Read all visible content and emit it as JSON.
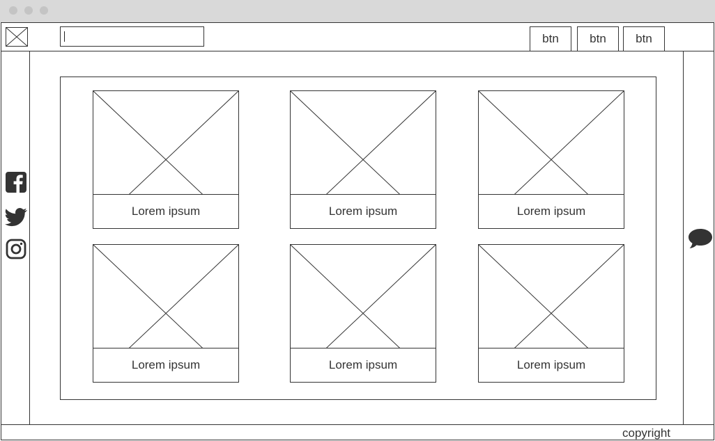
{
  "window": {
    "controls": [
      "close",
      "minimize",
      "maximize"
    ]
  },
  "header": {
    "logo_icon": "image-placeholder-icon",
    "search": {
      "value": "",
      "placeholder": ""
    },
    "buttons": [
      "btn",
      "btn",
      "btn"
    ]
  },
  "sidebar_left": {
    "icons": [
      "facebook-icon",
      "twitter-icon",
      "instagram-icon"
    ]
  },
  "sidebar_right": {
    "icons": [
      "chat-bubble-icon"
    ]
  },
  "cards": [
    {
      "label": "Lorem ipsum"
    },
    {
      "label": "Lorem ipsum"
    },
    {
      "label": "Lorem ipsum"
    },
    {
      "label": "Lorem ipsum"
    },
    {
      "label": "Lorem ipsum"
    },
    {
      "label": "Lorem ipsum"
    }
  ],
  "footer": {
    "copyright": "copyright"
  },
  "colors": {
    "stroke": "#333333",
    "titlebar": "#d9d9d9",
    "dot": "#c4c4c4",
    "icon": "#333333"
  }
}
